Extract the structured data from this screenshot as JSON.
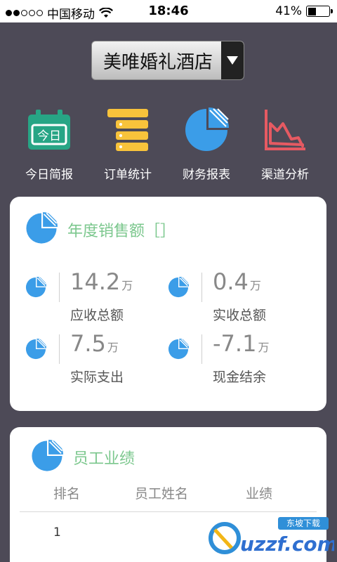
{
  "status_bar": {
    "carrier": "中国移动",
    "time": "18:46",
    "battery_percent": "41%",
    "battery_level": 0.41,
    "signal_bars_filled": 2,
    "signal_bars_total": 5
  },
  "hotel_select": {
    "value": "美唯婚礼酒店"
  },
  "quick_nav": [
    {
      "label": "今日简报",
      "icon": "calendar-today-icon",
      "icon_text": "今日",
      "color": "#27a585"
    },
    {
      "label": "订单统计",
      "icon": "stacked-list-icon",
      "color": "#f8c33b"
    },
    {
      "label": "财务报表",
      "icon": "pie-chart-icon",
      "color": "#3b9de8"
    },
    {
      "label": "渠道分析",
      "icon": "line-chart-icon",
      "color": "#e65a62"
    }
  ],
  "annual_sales": {
    "title": "年度销售额［］",
    "metrics": [
      {
        "value": "14.2",
        "unit": "万",
        "label": "应收总额"
      },
      {
        "value": "0.4",
        "unit": "万",
        "label": "实收总额"
      },
      {
        "value": "7.5",
        "unit": "万",
        "label": "实际支出"
      },
      {
        "value": "-7.1",
        "unit": "万",
        "label": "现金结余"
      }
    ]
  },
  "staff_performance": {
    "title": "员工业绩",
    "columns": [
      "排名",
      "员工姓名",
      "业绩"
    ],
    "rows": [
      {
        "rank": "1",
        "name": "",
        "score": ""
      }
    ]
  },
  "watermark": {
    "text": "uzzf.com",
    "badge": "东坡下载"
  },
  "colors": {
    "background": "#4d4a57",
    "accent_green": "#7bc78d",
    "pie_blue": "#3b9de8"
  }
}
